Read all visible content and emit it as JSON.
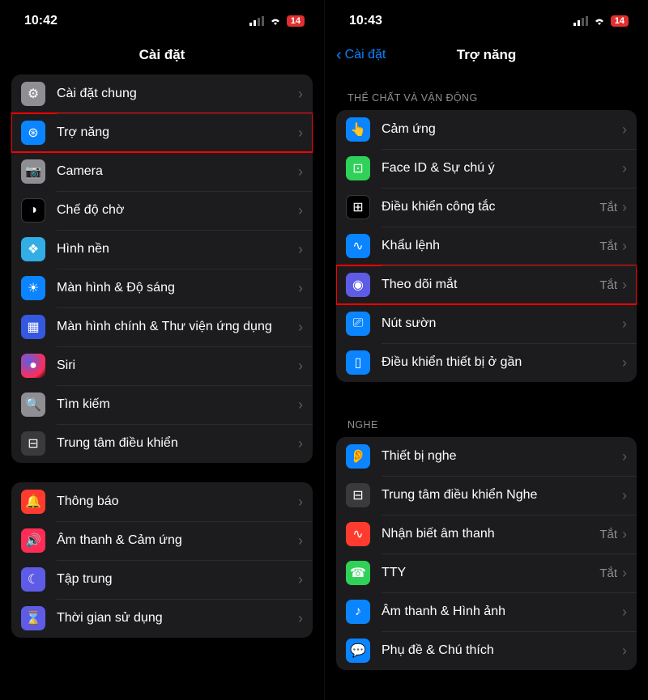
{
  "left": {
    "status": {
      "time": "10:42",
      "battery": "14"
    },
    "nav": {
      "title": "Cài đặt"
    },
    "group1": [
      {
        "icon": "gear-icon",
        "bg": "bg-gray",
        "label": "Cài đặt chung"
      },
      {
        "icon": "accessibility-icon",
        "bg": "bg-blue",
        "label": "Trợ năng",
        "highlight": true
      },
      {
        "icon": "camera-icon",
        "bg": "bg-gray",
        "label": "Camera"
      },
      {
        "icon": "standby-icon",
        "bg": "bg-black",
        "label": "Chế độ chờ"
      },
      {
        "icon": "wallpaper-icon",
        "bg": "bg-cyan",
        "label": "Hình nền"
      },
      {
        "icon": "brightness-icon",
        "bg": "bg-blue",
        "label": "Màn hình & Độ sáng"
      },
      {
        "icon": "homescreen-icon",
        "bg": "bg-indigo",
        "label": "Màn hình chính & Thư viện ứng dụng"
      },
      {
        "icon": "siri-icon",
        "bg": "bg-siri",
        "label": "Siri"
      },
      {
        "icon": "search-icon",
        "bg": "bg-gray",
        "label": "Tìm kiếm"
      },
      {
        "icon": "control-center-icon",
        "bg": "bg-darkgray",
        "label": "Trung tâm điều khiển"
      }
    ],
    "group2": [
      {
        "icon": "notifications-icon",
        "bg": "bg-red",
        "label": "Thông báo"
      },
      {
        "icon": "sounds-icon",
        "bg": "bg-pink",
        "label": "Âm thanh & Cảm ứng"
      },
      {
        "icon": "focus-icon",
        "bg": "bg-purple",
        "label": "Tập trung"
      },
      {
        "icon": "screentime-icon",
        "bg": "bg-purple",
        "label": "Thời gian sử dụng"
      }
    ]
  },
  "right": {
    "status": {
      "time": "10:43",
      "battery": "14"
    },
    "nav": {
      "back": "Cài đặt",
      "title": "Trợ năng"
    },
    "sections": [
      {
        "header": "THỂ CHẤT VÀ VẬN ĐỘNG",
        "rows": [
          {
            "icon": "touch-icon",
            "bg": "bg-blue",
            "label": "Cảm ứng"
          },
          {
            "icon": "faceid-icon",
            "bg": "bg-green",
            "label": "Face ID & Sự chú ý"
          },
          {
            "icon": "switch-control-icon",
            "bg": "bg-black",
            "label": "Điều khiển công tắc",
            "value": "Tắt"
          },
          {
            "icon": "voice-control-icon",
            "bg": "bg-blue",
            "label": "Khẩu lệnh",
            "value": "Tắt"
          },
          {
            "icon": "eye-tracking-icon",
            "bg": "bg-purple",
            "label": "Theo dõi mắt",
            "value": "Tắt",
            "highlight": true
          },
          {
            "icon": "side-button-icon",
            "bg": "bg-blue",
            "label": "Nút sườn"
          },
          {
            "icon": "nearby-device-icon",
            "bg": "bg-blue",
            "label": "Điều khiển thiết bị ở gần"
          }
        ]
      },
      {
        "header": "NGHE",
        "rows": [
          {
            "icon": "hearing-device-icon",
            "bg": "bg-blue",
            "label": "Thiết bị nghe"
          },
          {
            "icon": "hearing-cc-icon",
            "bg": "bg-darkgray",
            "label": "Trung tâm điều khiển Nghe"
          },
          {
            "icon": "sound-recognition-icon",
            "bg": "bg-red",
            "label": "Nhận biết âm thanh",
            "value": "Tắt"
          },
          {
            "icon": "tty-icon",
            "bg": "bg-green",
            "label": "TTY",
            "value": "Tắt"
          },
          {
            "icon": "audio-visual-icon",
            "bg": "bg-blue",
            "label": "Âm thanh & Hình ảnh"
          },
          {
            "icon": "subtitles-icon",
            "bg": "bg-blue",
            "label": "Phụ đề & Chú thích"
          }
        ]
      }
    ]
  },
  "glyphs": {
    "gear-icon": "⚙︎",
    "accessibility-icon": "⊛",
    "camera-icon": "📷",
    "standby-icon": "◑",
    "wallpaper-icon": "❖",
    "brightness-icon": "☀",
    "homescreen-icon": "▦",
    "siri-icon": "●",
    "search-icon": "🔍",
    "control-center-icon": "⊟",
    "notifications-icon": "🔔",
    "sounds-icon": "🔊",
    "focus-icon": "☾",
    "screentime-icon": "⌛",
    "touch-icon": "👆",
    "faceid-icon": "⊡",
    "switch-control-icon": "⊞",
    "voice-control-icon": "∿",
    "eye-tracking-icon": "◉",
    "side-button-icon": "⎚",
    "nearby-device-icon": "▯",
    "hearing-device-icon": "👂",
    "hearing-cc-icon": "⊟",
    "sound-recognition-icon": "∿",
    "tty-icon": "☎",
    "audio-visual-icon": "♪",
    "subtitles-icon": "💬"
  }
}
